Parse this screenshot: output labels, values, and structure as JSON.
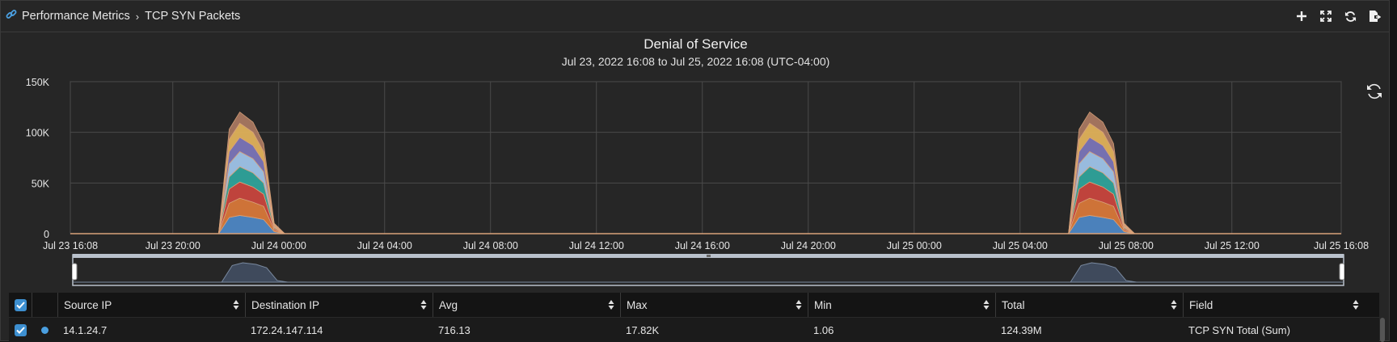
{
  "breadcrumb": {
    "root": "Performance Metrics",
    "current": "TCP SYN Packets"
  },
  "toolbar_icons": [
    "plus-icon",
    "expand-icon",
    "sync-icon",
    "export-icon"
  ],
  "chart_data": {
    "type": "area",
    "title": "Denial of Service",
    "subtitle": "Jul 23, 2022 16:08 to Jul 25, 2022 16:08 (UTC-04:00)",
    "y_ticks": [
      "150K",
      "100K",
      "50K",
      "0"
    ],
    "ylim": [
      0,
      150000
    ],
    "x_ticks": [
      "Jul 23 16:08",
      "Jul 23 20:00",
      "Jul 24 00:00",
      "Jul 24 04:00",
      "Jul 24 08:00",
      "Jul 24 12:00",
      "Jul 24 16:00",
      "Jul 24 20:00",
      "Jul 25 00:00",
      "Jul 25 04:00",
      "Jul 25 08:00",
      "Jul 25 12:00",
      "Jul 25 16:08"
    ],
    "x_hours": [
      0,
      3.87,
      7.87,
      11.87,
      15.87,
      19.87,
      23.87,
      27.87,
      31.87,
      35.87,
      39.87,
      43.87,
      48
    ],
    "grid": true,
    "stacked": true,
    "sample_hours": [
      5.6,
      6.0,
      6.4,
      6.9,
      7.3,
      7.7,
      8.1,
      37.7,
      38.1,
      38.5,
      39.0,
      39.4,
      39.8,
      40.2
    ],
    "series": [
      {
        "color": "#4e86c4",
        "values": [
          0,
          16000,
          18000,
          16000,
          14000,
          2000,
          0,
          0,
          16000,
          18000,
          16000,
          14000,
          2000,
          0
        ]
      },
      {
        "color": "#d8783a",
        "values": [
          0,
          14000,
          17000,
          15000,
          13000,
          1500,
          0,
          0,
          14000,
          17000,
          15000,
          13000,
          1500,
          0
        ]
      },
      {
        "color": "#c8453e",
        "values": [
          0,
          14000,
          16000,
          15000,
          12000,
          1500,
          0,
          0,
          14000,
          16000,
          15000,
          12000,
          1500,
          0
        ]
      },
      {
        "color": "#2fa39a",
        "values": [
          0,
          12000,
          15000,
          14000,
          11000,
          1200,
          0,
          0,
          12000,
          15000,
          14000,
          11000,
          1200,
          0
        ]
      },
      {
        "color": "#9fc4e8",
        "values": [
          0,
          13000,
          15000,
          14000,
          11000,
          1200,
          0,
          0,
          13000,
          15000,
          14000,
          11000,
          1200,
          0
        ]
      },
      {
        "color": "#7b74b8",
        "values": [
          0,
          12000,
          14000,
          13000,
          10000,
          1000,
          0,
          0,
          12000,
          14000,
          13000,
          10000,
          1000,
          0
        ]
      },
      {
        "color": "#e0b25a",
        "values": [
          0,
          12000,
          14000,
          13000,
          10000,
          1000,
          0,
          0,
          12000,
          14000,
          13000,
          10000,
          1000,
          0
        ]
      },
      {
        "color": "#a87860",
        "values": [
          0,
          10000,
          11000,
          10000,
          8000,
          800,
          0,
          0,
          10000,
          11000,
          10000,
          8000,
          800,
          0
        ]
      }
    ]
  },
  "table": {
    "columns": [
      "Source IP",
      "Destination IP",
      "Avg",
      "Max",
      "Min",
      "Total",
      "Field"
    ],
    "rows": [
      {
        "source_ip": "14.1.24.7",
        "destination_ip": "172.24.147.114",
        "avg": "716.13",
        "max": "17.82K",
        "min": "1.06",
        "total": "124.39M",
        "field": "TCP SYN Total (Sum)",
        "color": "#4a9fe0",
        "checked": true
      }
    ]
  },
  "colors": {
    "accent": "#3d8fd0",
    "panel": "#262626",
    "grid": "#4a4a4a"
  }
}
